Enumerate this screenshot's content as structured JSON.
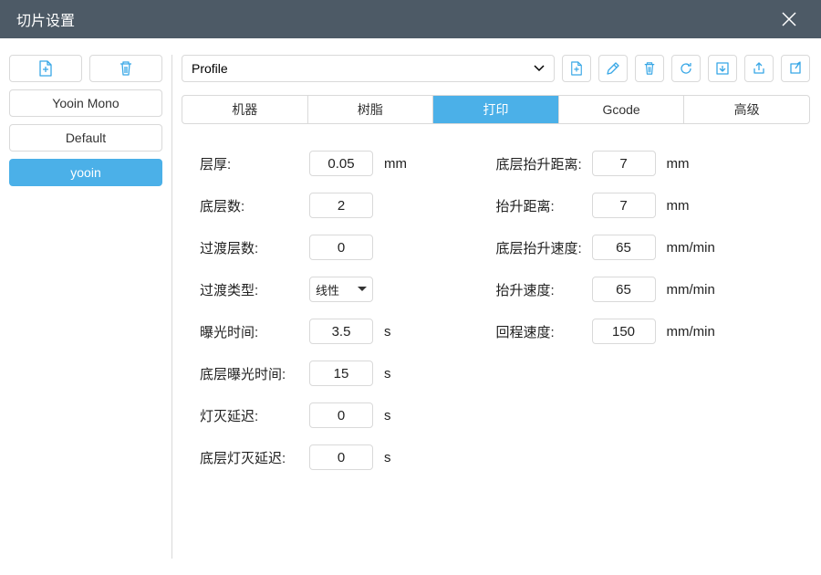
{
  "title": "切片设置",
  "sidebar": {
    "profiles": [
      {
        "name": "Yooin Mono",
        "active": false
      },
      {
        "name": "Default",
        "active": false
      },
      {
        "name": "yooin",
        "active": true
      }
    ]
  },
  "profileSelect": {
    "label": "Profile"
  },
  "tabs": [
    {
      "label": "机器",
      "active": false
    },
    {
      "label": "树脂",
      "active": false
    },
    {
      "label": "打印",
      "active": true
    },
    {
      "label": "Gcode",
      "active": false
    },
    {
      "label": "高级",
      "active": false
    }
  ],
  "leftFields": [
    {
      "label": "层厚:",
      "value": "0.05",
      "unit": "mm",
      "type": "input"
    },
    {
      "label": "底层数:",
      "value": "2",
      "unit": "",
      "type": "input"
    },
    {
      "label": "过渡层数:",
      "value": "0",
      "unit": "",
      "type": "input"
    },
    {
      "label": "过渡类型:",
      "value": "线性",
      "unit": "",
      "type": "select"
    },
    {
      "label": "曝光时间:",
      "value": "3.5",
      "unit": "s",
      "type": "input"
    },
    {
      "label": "底层曝光时间:",
      "value": "15",
      "unit": "s",
      "type": "input"
    },
    {
      "label": "灯灭延迟:",
      "value": "0",
      "unit": "s",
      "type": "input"
    },
    {
      "label": "底层灯灭延迟:",
      "value": "0",
      "unit": "s",
      "type": "input"
    }
  ],
  "rightFields": [
    {
      "label": "底层抬升距离:",
      "value": "7",
      "unit": "mm"
    },
    {
      "label": "抬升距离:",
      "value": "7",
      "unit": "mm"
    },
    {
      "label": "底层抬升速度:",
      "value": "65",
      "unit": "mm/min"
    },
    {
      "label": "抬升速度:",
      "value": "65",
      "unit": "mm/min"
    },
    {
      "label": "回程速度:",
      "value": "150",
      "unit": "mm/min"
    }
  ]
}
